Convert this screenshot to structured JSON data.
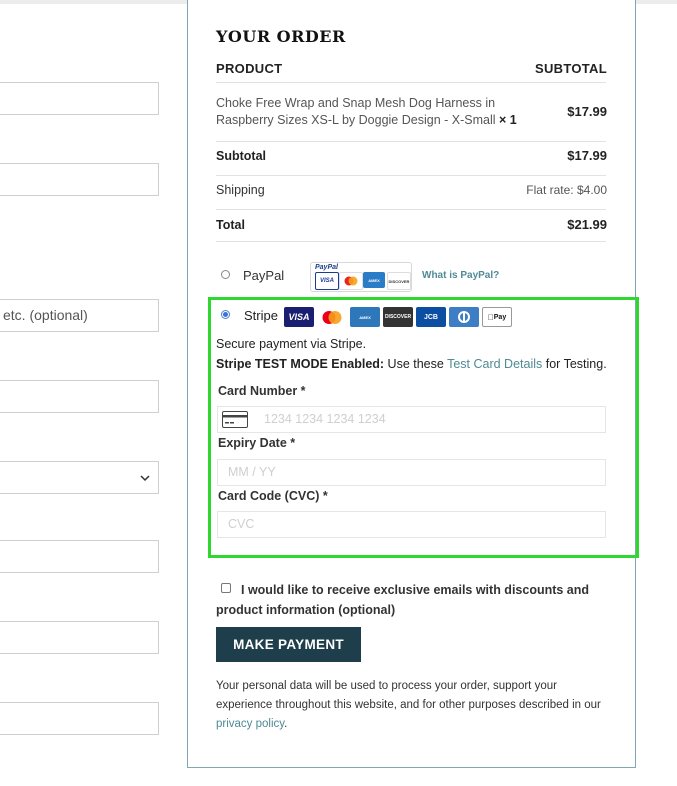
{
  "left_form": {
    "address2_placeholder": "etc. (optional)"
  },
  "order": {
    "title": "YOUR ORDER",
    "col_product": "PRODUCT",
    "col_subtotal": "SUBTOTAL",
    "item_name": "Choke Free Wrap and Snap  Mesh Dog Harness in Raspberry Sizes XS-L by Doggie Design - X-Small",
    "item_qty": "× 1",
    "item_price": "$17.99",
    "subtotal_label": "Subtotal",
    "subtotal_value": "$17.99",
    "shipping_label": "Shipping",
    "shipping_value": "Flat rate: $4.00",
    "total_label": "Total",
    "total_value": "$21.99"
  },
  "payment": {
    "paypal_label": "PayPal",
    "paypal_brand": "PayPal",
    "paypal_cards": [
      "VISA",
      "MC",
      "AMEX",
      "DISCOVER"
    ],
    "what_is_paypal": "What is PayPal?",
    "stripe_label": "Stripe",
    "stripe_cards": [
      "VISA",
      "MC",
      "AMEX",
      "DISCOVER",
      "JCB",
      "DC",
      "Pay"
    ],
    "secure_text": "Secure payment via Stripe.",
    "test_mode_bold": "Stripe TEST MODE Enabled:",
    "test_mode_pre": " Use these ",
    "test_mode_link": "Test Card Details",
    "test_mode_post": " for Testing.",
    "card_number_label": "Card Number *",
    "card_number_placeholder": "1234 1234 1234 1234",
    "expiry_label": "Expiry Date *",
    "expiry_placeholder": "MM / YY",
    "cvc_label": "Card Code (CVC) *",
    "cvc_placeholder": "CVC"
  },
  "consent": {
    "text": "I would like to receive exclusive emails with discounts and product information (optional)"
  },
  "actions": {
    "pay_label": "MAKE PAYMENT"
  },
  "privacy": {
    "pre": "Your personal data will be used to process your order, support your experience throughout this website, and for other purposes described in our ",
    "link": "privacy policy",
    "post": "."
  },
  "colors": {
    "accent_link": "#4f8a96",
    "button_bg": "#1f3e4b",
    "highlight_border": "#2fd82f",
    "panel_border": "#7fa9b1"
  }
}
